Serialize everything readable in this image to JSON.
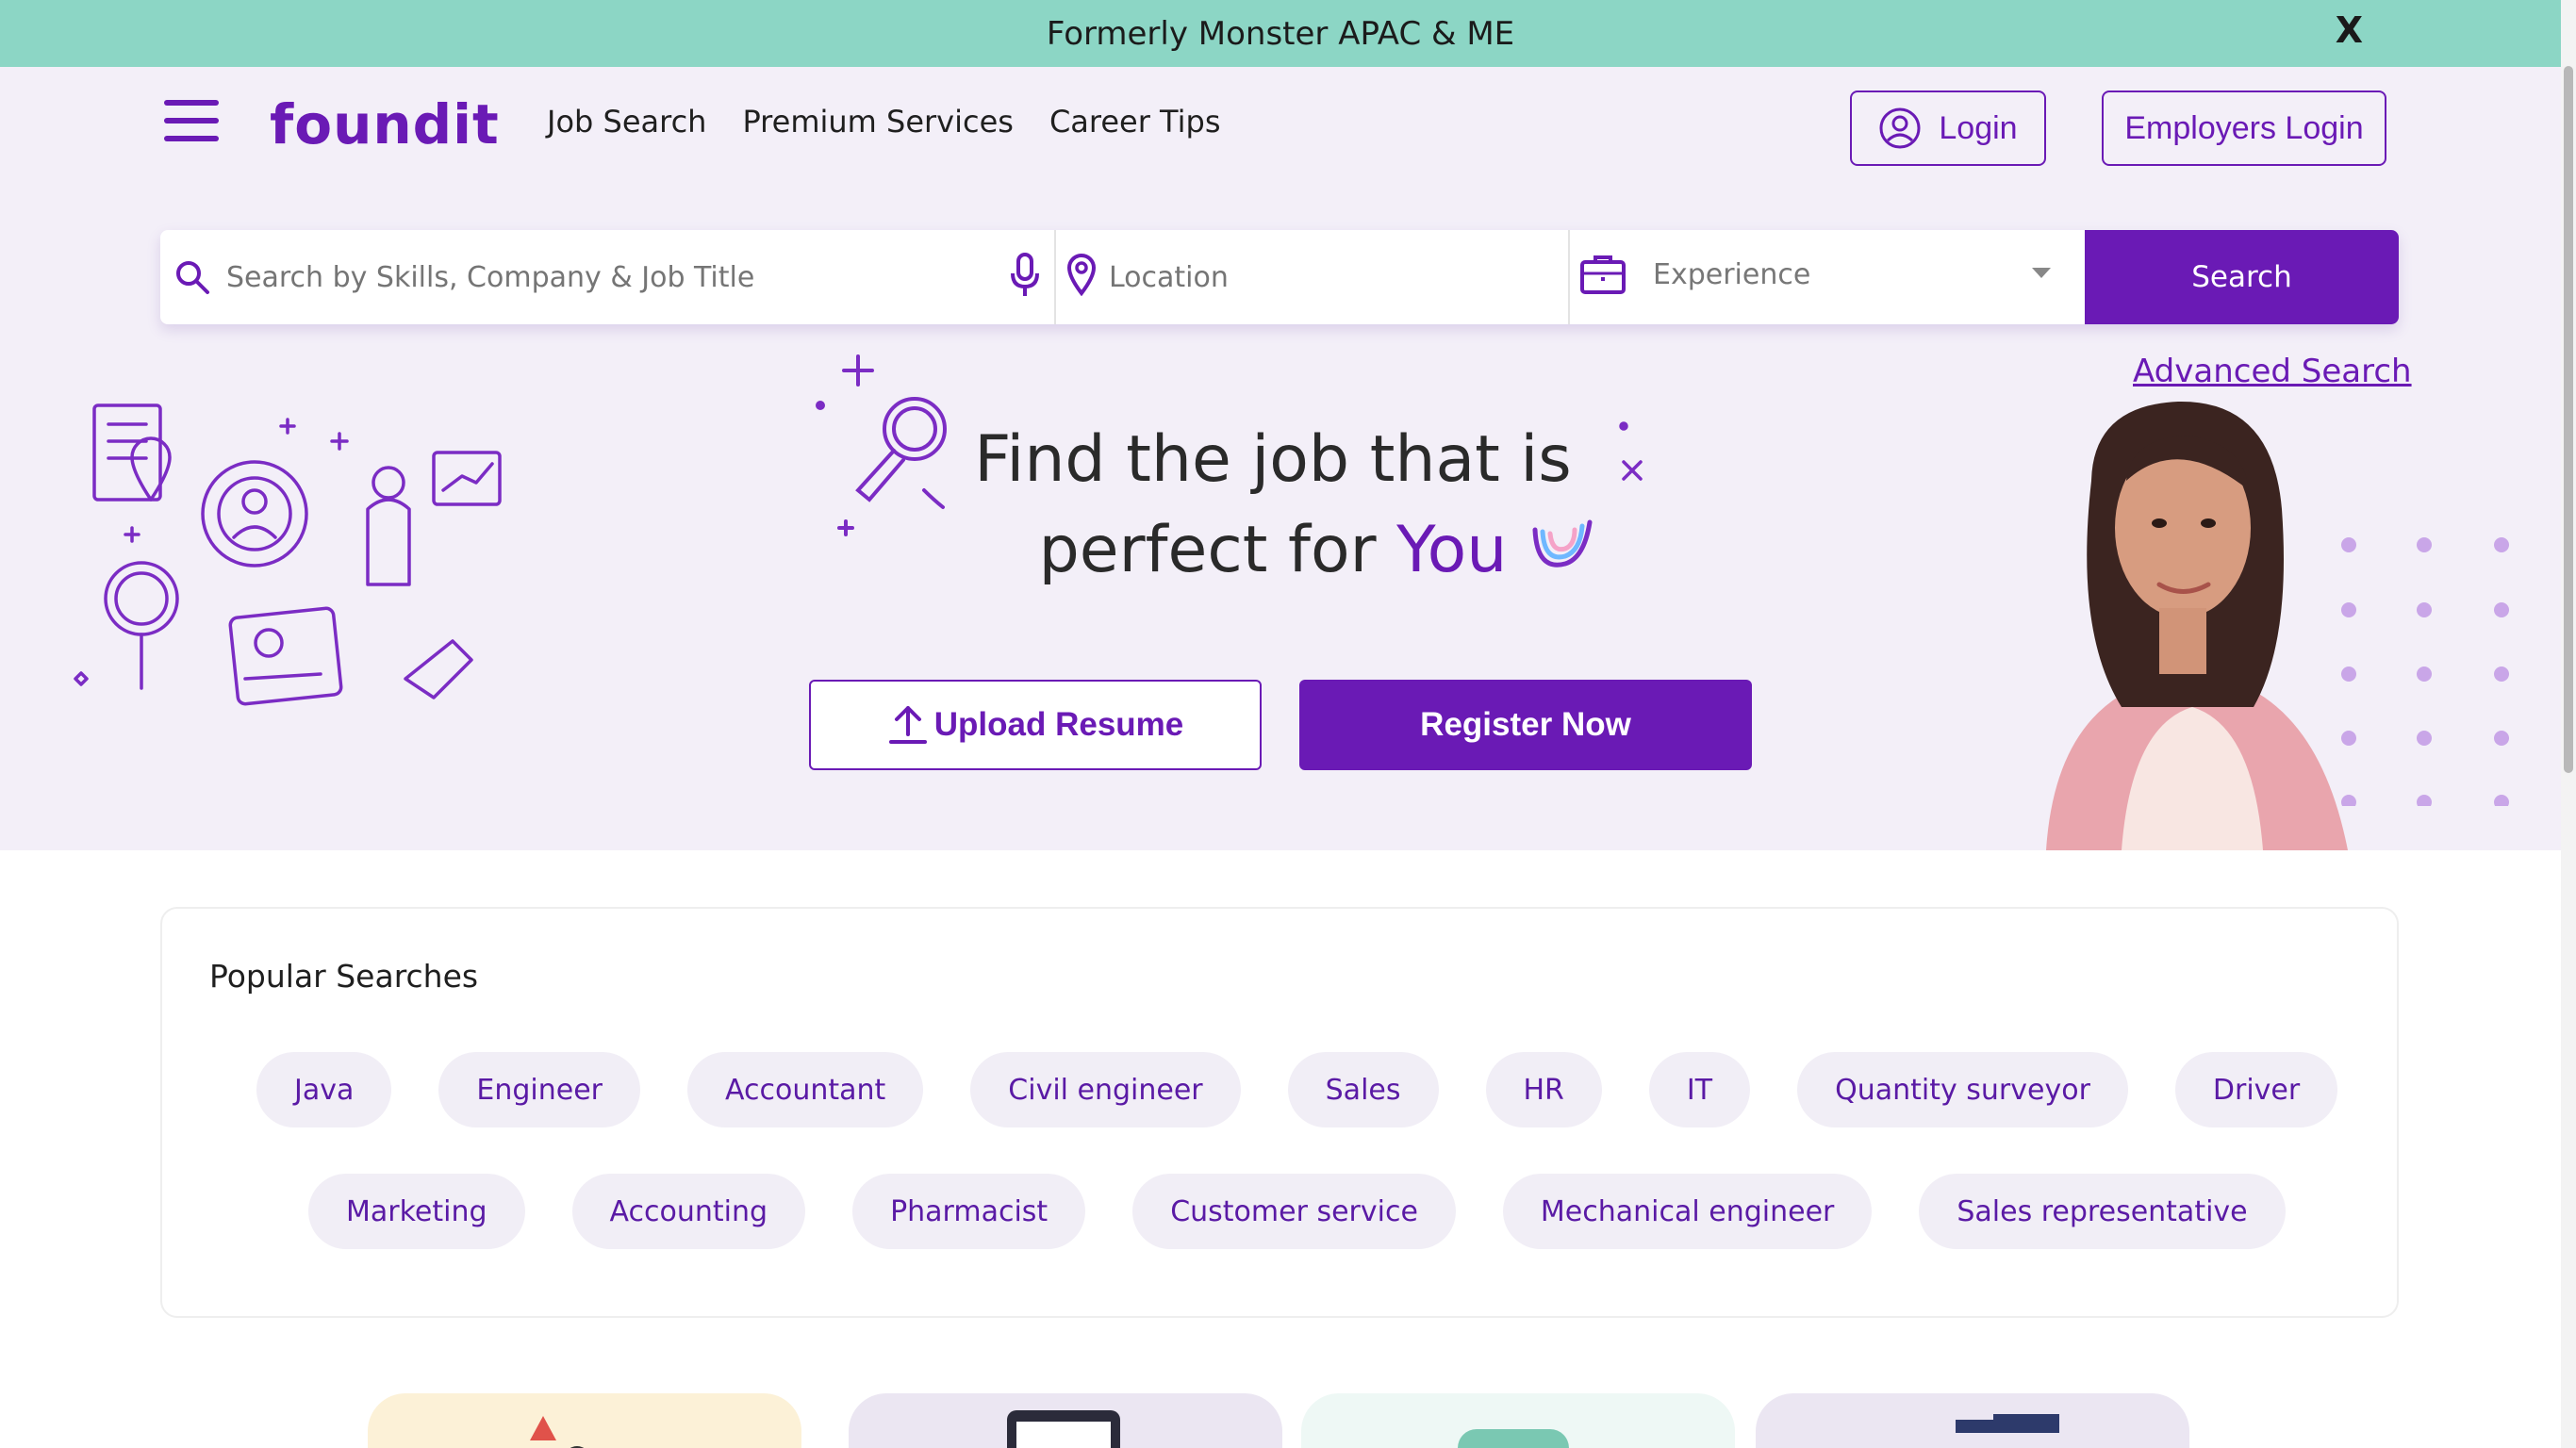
{
  "banner": {
    "text": "Formerly Monster APAC & ME",
    "close": "X"
  },
  "header": {
    "logo": "foundit",
    "nav": [
      "Job Search",
      "Premium Services",
      "Career Tips"
    ],
    "login": "Login",
    "employers_login": "Employers Login"
  },
  "search": {
    "skills_placeholder": "Search by Skills, Company & Job Title",
    "location_placeholder": "Location",
    "experience": "Experience",
    "button": "Search",
    "advanced": "Advanced Search"
  },
  "hero": {
    "title_line1": "Find the job that is",
    "title_line2_prefix": "perfect for ",
    "title_highlight": "You",
    "upload": "Upload Resume",
    "register": "Register Now"
  },
  "popular": {
    "title": "Popular Searches",
    "row1": [
      "Java",
      "Engineer",
      "Accountant",
      "Civil engineer",
      "Sales",
      "HR",
      "IT",
      "Quantity surveyor",
      "Driver"
    ],
    "row2": [
      "Marketing",
      "Accounting",
      "Pharmacist",
      "Customer service",
      "Mechanical engineer",
      "Sales representative"
    ]
  },
  "colors": {
    "brand": "#6a1ab5",
    "banner": "#8cd6c5",
    "hero_bg": "#f3eff8",
    "chip_bg": "#f1eef6"
  },
  "icons": [
    "menu-icon",
    "user-circle-icon",
    "search-icon",
    "mic-icon",
    "location-pin-icon",
    "briefcase-icon",
    "upload-icon",
    "close-icon"
  ]
}
